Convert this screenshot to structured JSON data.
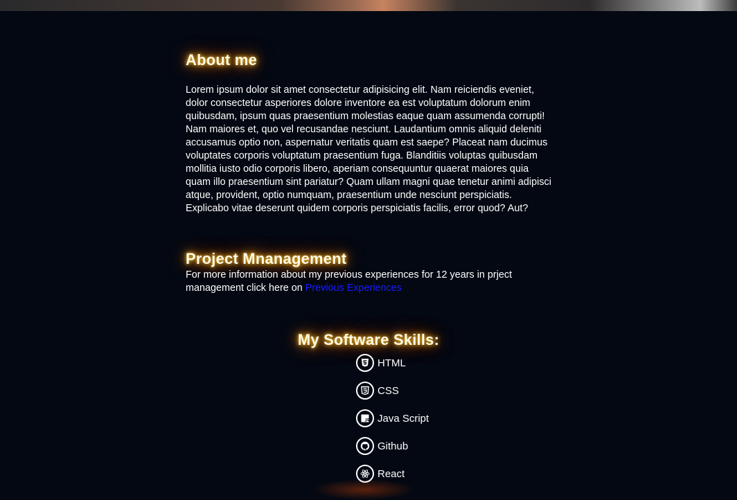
{
  "about": {
    "heading": "About me",
    "text": "Lorem ipsum dolor sit amet consectetur adipisicing elit. Nam reiciendis eveniet, dolor consectetur asperiores dolore inventore ea est voluptatum dolorum enim quibusdam, ipsum quas praesentium molestias eaque quam assumenda corrupti! Nam maiores et, quo vel recusandae nesciunt. Laudantium omnis aliquid deleniti accusamus optio non, aspernatur veritatis quam est saepe? Placeat nam ducimus voluptates corporis voluptatum praesentium fuga. Blanditiis voluptas quibusdam mollitia iusto odio corporis libero, aperiam consequuntur quaerat maiores quia quam illo praesentium sint pariatur? Quam ullam magni quae tenetur animi adipisci atque, provident, optio numquam, praesentium unde nesciunt perspiciatis. Explicabo vitae deserunt quidem corporis perspiciatis facilis, error quod? Aut?"
  },
  "project": {
    "heading": "Project Mnanagement",
    "text": "For more information about my previous experiences for 12 years in prject management click here on ",
    "link_label": "Previous Experiences"
  },
  "skills": {
    "heading": "My Software Skills:",
    "items": [
      {
        "label": "HTML",
        "icon": "html5-icon"
      },
      {
        "label": "CSS",
        "icon": "css3-icon"
      },
      {
        "label": "Java Script",
        "icon": "javascript-icon"
      },
      {
        "label": "Github",
        "icon": "github-icon"
      },
      {
        "label": "React",
        "icon": "react-icon"
      }
    ]
  },
  "colors": {
    "background": "#030812",
    "glow": "#ff9900",
    "link": "#1a1aff"
  }
}
